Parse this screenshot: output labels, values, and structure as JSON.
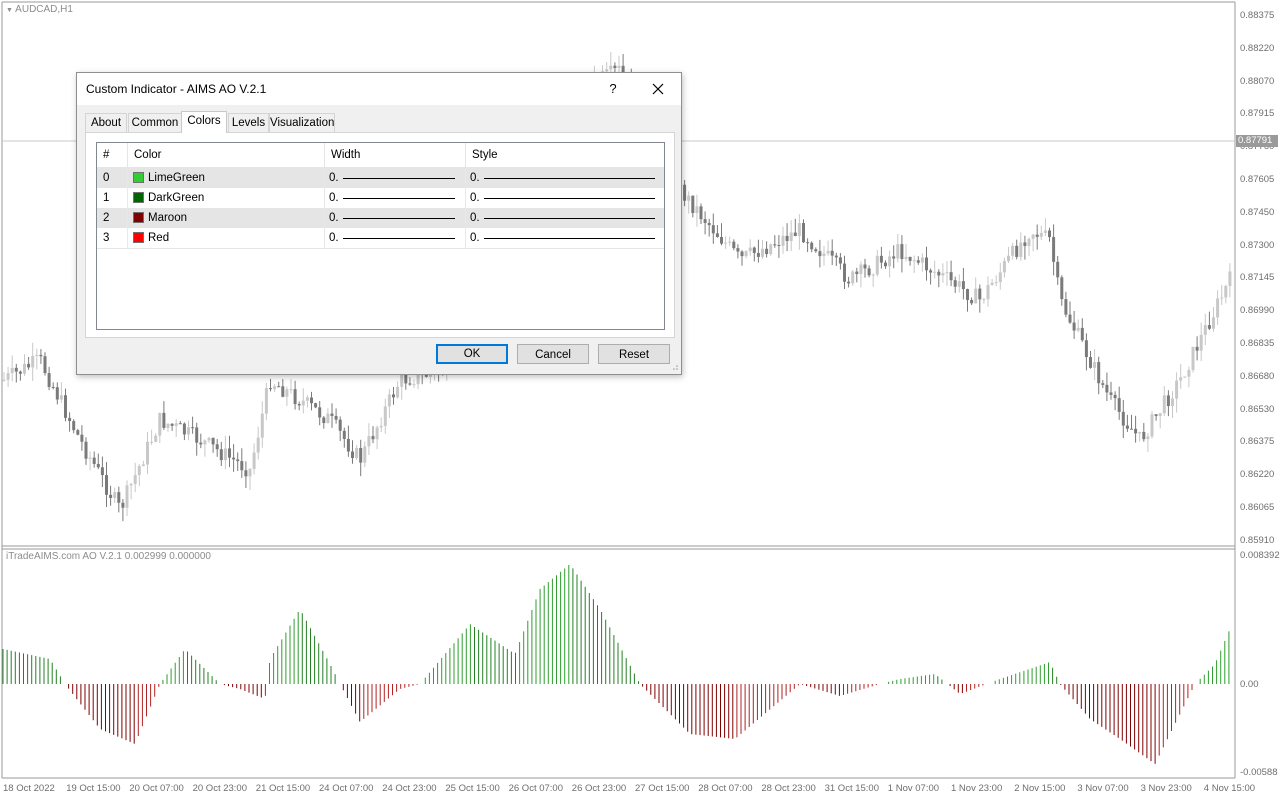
{
  "main_chart": {
    "title": "AUDCAD,H1",
    "price_axis": [
      "0.88375",
      "0.88220",
      "0.88070",
      "0.87915",
      "0.87760",
      "0.87605",
      "0.87450",
      "0.87300",
      "0.87145",
      "0.86990",
      "0.86835",
      "0.86680",
      "0.86530",
      "0.86375",
      "0.86220",
      "0.86065",
      "0.85910"
    ],
    "current_price_marker": "0.87791"
  },
  "indicator_pane": {
    "title": "iTradeAIMS.com AO V.2.1 0.002999 0.000000",
    "axis": [
      "0.008392",
      "0.00",
      "-0.00588"
    ]
  },
  "time_axis": [
    "18 Oct 2022",
    "19 Oct 15:00",
    "20 Oct 07:00",
    "20 Oct 23:00",
    "21 Oct 15:00",
    "24 Oct 07:00",
    "24 Oct 23:00",
    "25 Oct 15:00",
    "26 Oct 07:00",
    "26 Oct 23:00",
    "27 Oct 15:00",
    "28 Oct 07:00",
    "28 Oct 23:00",
    "31 Oct 15:00",
    "1 Nov 07:00",
    "1 Nov 23:00",
    "2 Nov 15:00",
    "3 Nov 07:00",
    "3 Nov 23:00",
    "4 Nov 15:00"
  ],
  "colors": {
    "up_candle": "#c8c8c8",
    "down_candle": "#7a7a7a",
    "ao_positive": "#32cd32",
    "ao_positive_dim": "#006400",
    "ao_negative": "#800000",
    "ao_negative_bright": "#ff0000"
  },
  "dialog": {
    "title": "Custom Indicator - AIMS AO V.2.1",
    "help_label": "?",
    "close_icon": "close-icon",
    "tabs": [
      {
        "label": "About"
      },
      {
        "label": "Common"
      },
      {
        "label": "Colors",
        "active": true
      },
      {
        "label": "Levels"
      },
      {
        "label": "Visualization"
      }
    ],
    "columns": {
      "index": "#",
      "color": "Color",
      "width": "Width",
      "style": "Style"
    },
    "rows": [
      {
        "index": "0",
        "color_name": "LimeGreen",
        "swatch": "#32cd32",
        "width": "0.",
        "style": "0."
      },
      {
        "index": "1",
        "color_name": "DarkGreen",
        "swatch": "#006400",
        "width": "0.",
        "style": "0."
      },
      {
        "index": "2",
        "color_name": "Maroon",
        "swatch": "#800000",
        "width": "0.",
        "style": "0."
      },
      {
        "index": "3",
        "color_name": "Red",
        "swatch": "#ff0000",
        "width": "0.",
        "style": "0."
      }
    ],
    "buttons": {
      "ok": "OK",
      "cancel": "Cancel",
      "reset": "Reset"
    }
  }
}
